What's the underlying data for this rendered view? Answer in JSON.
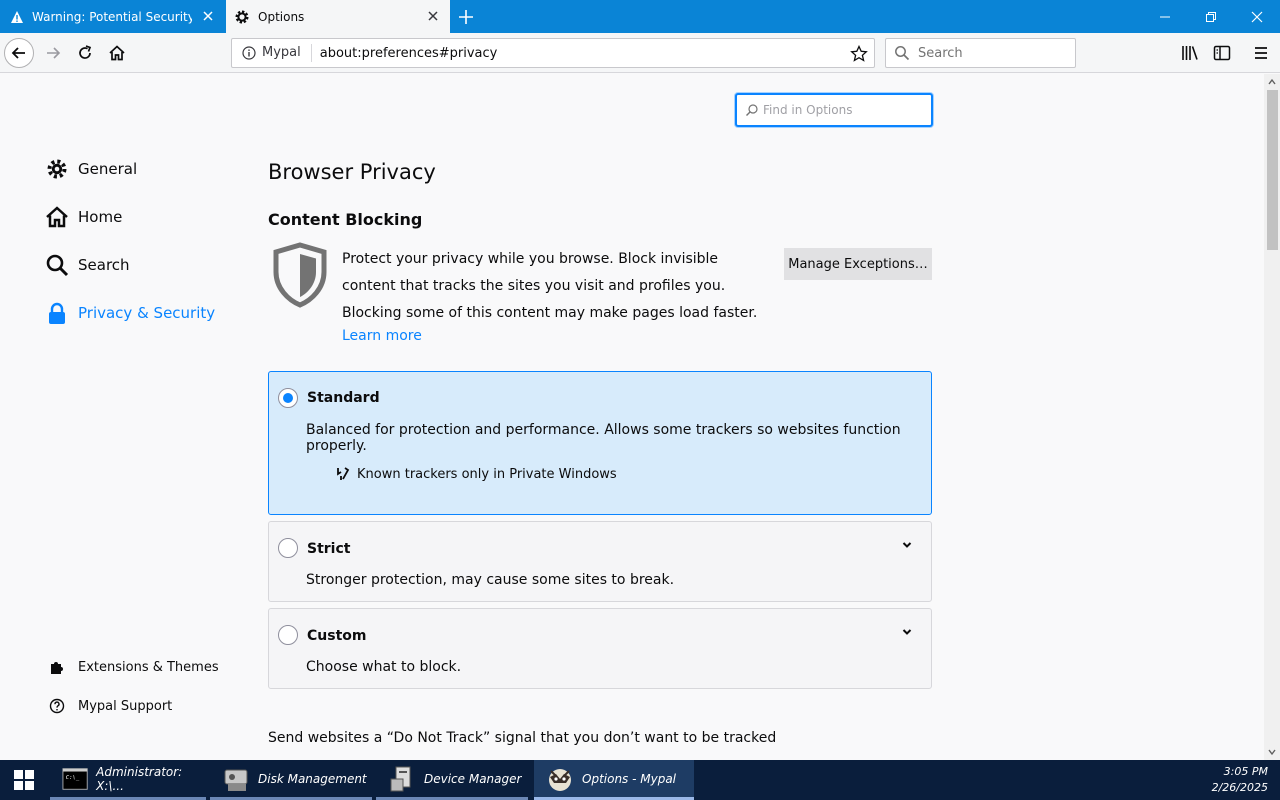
{
  "tabs": [
    {
      "title": "Warning: Potential Security Risk A",
      "active": false
    },
    {
      "title": "Options",
      "active": true
    }
  ],
  "nav": {
    "identity": "Mypal",
    "url": "about:preferences#privacy",
    "search_placeholder": "Search"
  },
  "prefs": {
    "find_placeholder": "Find in Options",
    "categories": [
      {
        "label": "General",
        "icon": "gear-icon"
      },
      {
        "label": "Home",
        "icon": "home-icon"
      },
      {
        "label": "Search",
        "icon": "search-icon"
      },
      {
        "label": "Privacy & Security",
        "icon": "lock-icon",
        "selected": true
      }
    ],
    "footer_links": [
      {
        "label": "Extensions & Themes",
        "icon": "puzzle-icon"
      },
      {
        "label": "Mypal Support",
        "icon": "help-icon"
      }
    ],
    "heading": "Browser Privacy",
    "section": "Content Blocking",
    "description": "Protect your privacy while you browse. Block invisible content that tracks the sites you visit and profiles you. Blocking some of this content may make pages load faster.",
    "learn_more": "Learn more",
    "manage_exceptions": "Manage Exceptions…",
    "options": [
      {
        "title": "Standard",
        "desc": "Balanced for protection and performance. Allows some trackers so websites function properly.",
        "detail": "Known trackers only in Private Windows",
        "selected": true
      },
      {
        "title": "Strict",
        "desc": "Stronger protection, may cause some sites to break.",
        "selected": false
      },
      {
        "title": "Custom",
        "desc": "Choose what to block.",
        "selected": false
      }
    ],
    "dnt_text": "Send websites a “Do Not Track” signal that you don’t want to be tracked"
  },
  "taskbar": {
    "items": [
      {
        "label": "Administrator: X:\\...",
        "active": false
      },
      {
        "label": "Disk Management",
        "active": false
      },
      {
        "label": "Device Manager",
        "active": false
      },
      {
        "label": "Options - Mypal",
        "active": true
      }
    ],
    "time": "3:05 PM",
    "date": "2/26/2025"
  },
  "colors": {
    "accent": "#0a84ff",
    "tabstrip": "#0a84d6",
    "selected_option_bg": "#d7ebfb",
    "taskbar": "#0a1e3c"
  }
}
